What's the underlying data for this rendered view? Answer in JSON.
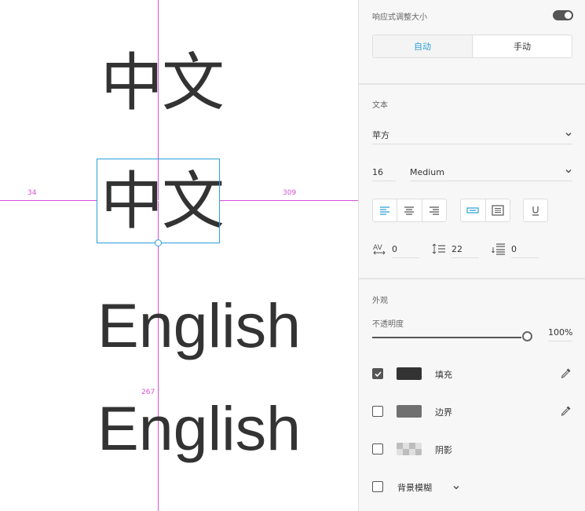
{
  "canvas": {
    "samples": {
      "cjk_top": "中文",
      "cjk_selected": "中文",
      "english_1": "English",
      "english_2": "English"
    },
    "measurements": {
      "left": "34",
      "right": "309",
      "below": "267"
    }
  },
  "panel": {
    "responsive": {
      "label": "响应式调整大小",
      "toggle_on": true,
      "modes": [
        "自动",
        "手动"
      ],
      "active_mode": "自动"
    },
    "text": {
      "section_title": "文本",
      "font_family": "苹方",
      "font_size": "16",
      "font_weight": "Medium",
      "align_icons": [
        "align-left-icon",
        "align-center-icon",
        "align-right-icon"
      ],
      "box_icons": [
        "auto-width-icon",
        "fixed-size-icon"
      ],
      "underline_icon": "underline-icon",
      "char_spacing": "0",
      "line_spacing": "22",
      "paragraph_spacing": "0"
    },
    "appearance": {
      "section_title": "外观",
      "opacity_label": "不透明度",
      "opacity": "100%",
      "opacity_level": 1.0,
      "fill_label": "填充",
      "fill_checked": true,
      "fill_color": "#333333",
      "border_label": "边界",
      "border_checked": false,
      "border_color": "#707070",
      "shadow_label": "阴影",
      "shadow_checked": false,
      "bg_blur_label": "背景模糊",
      "bg_blur_checked": false
    },
    "colors": {
      "accent": "#2a9fd6",
      "guide": "#d94fd9"
    }
  }
}
